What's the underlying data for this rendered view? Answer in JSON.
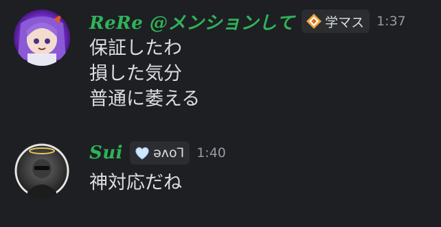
{
  "messages": [
    {
      "username": "ReRe @メンションして",
      "tag": {
        "icon": "orange-diamond-icon",
        "text": "学マス"
      },
      "timestamp": "1:37",
      "username_color": "#2fb35a",
      "lines": [
        "保証したわ",
        "損した気分",
        "普通に萎える"
      ]
    },
    {
      "username": "Sui",
      "tag": {
        "icon": "heart-icon",
        "text": "əʌoꞀ"
      },
      "timestamp": "1:40",
      "username_color": "#2fb35a",
      "lines": [
        "神対応だね"
      ]
    }
  ],
  "colors": {
    "background": "#1e1f22",
    "text": "#dbdee1",
    "timestamp": "#949ba4",
    "tag_bg": "#2b2d31"
  }
}
